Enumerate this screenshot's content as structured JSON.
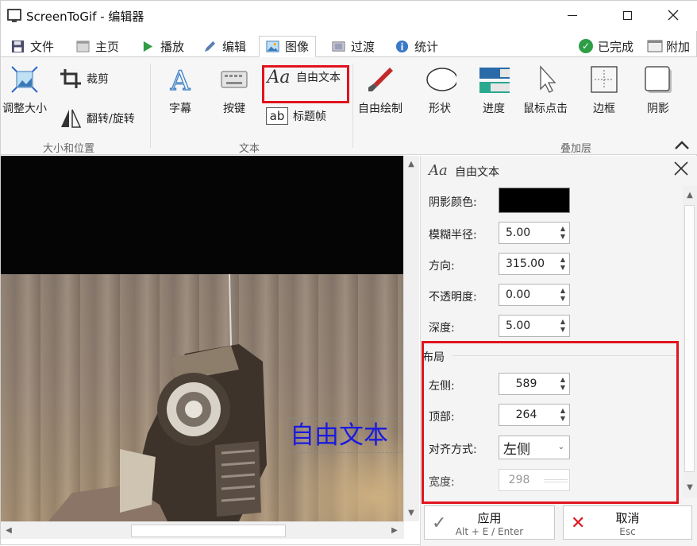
{
  "window": {
    "title": "ScreenToGif - 编辑器"
  },
  "tabs": [
    {
      "label": "文件"
    },
    {
      "label": "主页"
    },
    {
      "label": "播放"
    },
    {
      "label": "编辑"
    },
    {
      "label": "图像"
    },
    {
      "label": "过渡"
    },
    {
      "label": "统计"
    }
  ],
  "status": {
    "done": "已完成",
    "attach": "附加"
  },
  "ribbon": {
    "resize": "调整大小",
    "crop": "裁剪",
    "flip_rotate": "翻转/旋转",
    "group_size_position": "大小和位置",
    "caption": "字幕",
    "key_strokes": "按键",
    "free_text": "自由文本",
    "title_frame": "标题帧",
    "group_text": "文本",
    "free_drawing": "自由绘制",
    "shapes": "形状",
    "progress": "进度",
    "mouse_clicks": "鼠标点击",
    "border": "边框",
    "shadow": "阴影",
    "group_overlay": "叠加层"
  },
  "canvas": {
    "free_text": "自由文本"
  },
  "panel": {
    "title": "自由文本",
    "shadow_color_label": "阴影颜色:",
    "shadow_color": "#000000",
    "blur_radius_label": "模糊半径:",
    "blur_radius": "5.00",
    "direction_label": "方向:",
    "direction": "315.00",
    "opacity_label": "不透明度:",
    "opacity": "0.00",
    "depth_label": "深度:",
    "depth": "5.00",
    "layout_section": "布局",
    "left_label": "左侧:",
    "left": "589",
    "top_label": "顶部:",
    "top": "264",
    "alignment_label": "对齐方式:",
    "alignment": "左侧",
    "width_label": "宽度:",
    "width": "298"
  },
  "footer": {
    "apply_label": "应用",
    "apply_shortcut": "Alt + E / Enter",
    "cancel_label": "取消",
    "cancel_shortcut": "Esc"
  },
  "colors": {
    "accent_blue": "#1a1adf",
    "highlight_red": "#e0141e",
    "done_green": "#2e9e46"
  }
}
